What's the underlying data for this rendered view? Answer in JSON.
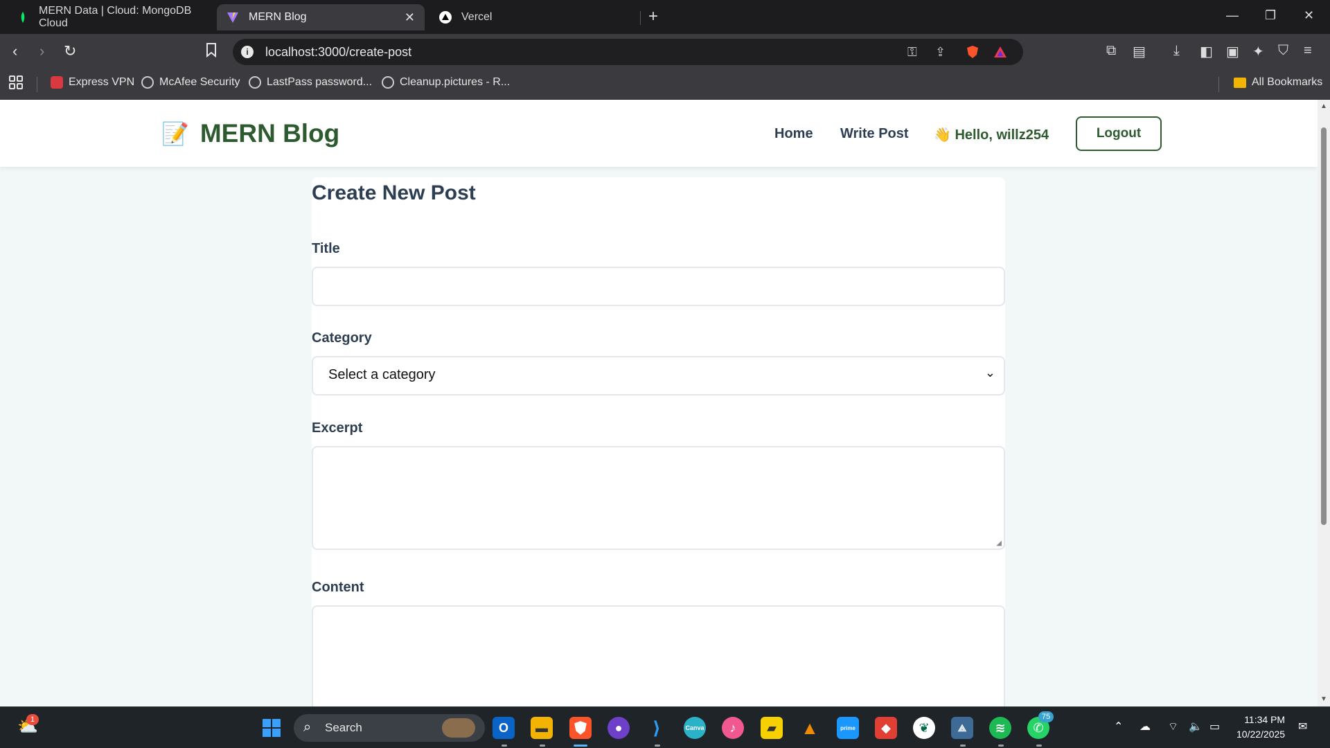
{
  "browser": {
    "tabs": [
      {
        "title": "MERN Data | Cloud: MongoDB Cloud"
      },
      {
        "title": "MERN Blog",
        "close": "✕"
      },
      {
        "title": "Vercel"
      }
    ],
    "url": "localhost:3000/create-post",
    "bookmarks": [
      "Express VPN",
      "McAfee Security",
      "LastPass password...",
      "Cleanup.pictures - R..."
    ],
    "all_bookmarks": "All Bookmarks"
  },
  "site": {
    "brand": "MERN Blog",
    "nav": {
      "home": "Home",
      "write": "Write Post"
    },
    "greeting": "👋 Hello, willz254",
    "logout": "Logout"
  },
  "form": {
    "title": "Create New Post",
    "title_label": "Title",
    "category_label": "Category",
    "category_selected": "Select a category",
    "excerpt_label": "Excerpt",
    "content_label": "Content"
  },
  "taskbar": {
    "search": "Search",
    "weather_badge": "1",
    "whatsapp_badge": "75",
    "time": "11:34 PM",
    "date": "10/22/2025"
  },
  "colors": {
    "brand_green": "#2d5a2e",
    "page_bg": "#f2f7f8",
    "text_dark": "#2c3e50"
  }
}
